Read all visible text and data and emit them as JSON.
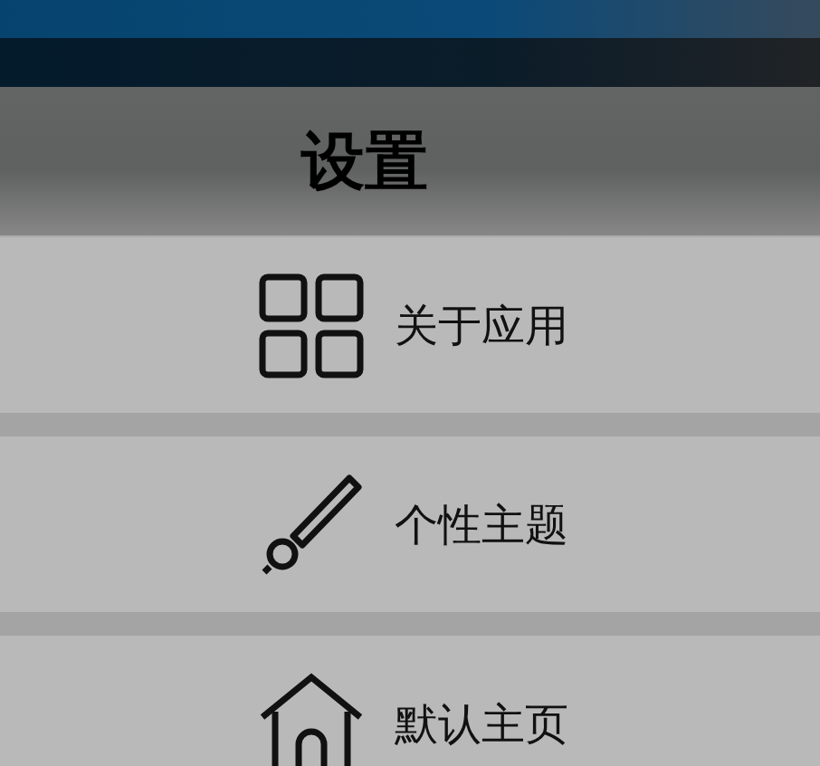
{
  "title": "设置",
  "items": [
    {
      "label": "关于应用",
      "kind": "grid"
    },
    {
      "label": "个性主题",
      "kind": "brush"
    },
    {
      "label": "默认主页",
      "kind": "house"
    }
  ]
}
